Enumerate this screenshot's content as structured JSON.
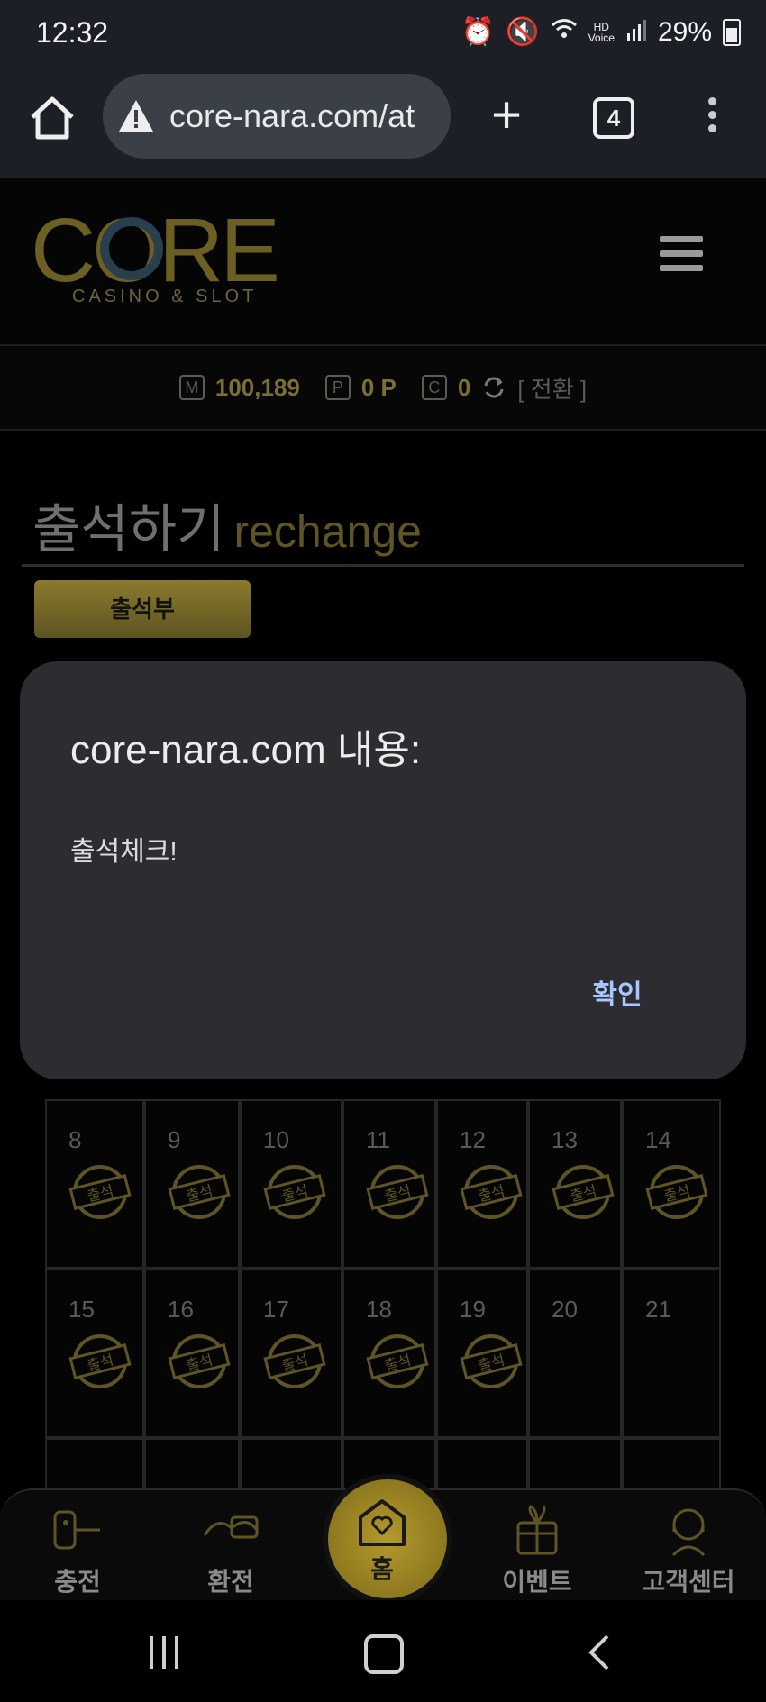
{
  "status": {
    "time": "12:32",
    "battery": "29%",
    "icons": [
      "alarm-icon",
      "mute-icon",
      "wifi-icon",
      "hd-voice-icon",
      "signal-icon",
      "battery-icon"
    ]
  },
  "browser": {
    "url": "core-nara.com/at",
    "tab_count": "4"
  },
  "site": {
    "logo_text": "CORE",
    "logo_sub": "CASINO & SLOT",
    "balance": {
      "m_badge": "M",
      "money": "100,189",
      "p_badge": "P",
      "points": "0 P",
      "c_badge": "C",
      "coins": "0",
      "switch_label": "[ 전환 ]"
    },
    "page_title_ko": "출석하기",
    "page_title_en": "rechange",
    "tab_label": "출석부"
  },
  "calendar": {
    "stamp_label": "출석",
    "rows": [
      [
        {
          "day": "8",
          "stamped": true
        },
        {
          "day": "9",
          "stamped": true
        },
        {
          "day": "10",
          "stamped": true
        },
        {
          "day": "11",
          "stamped": true
        },
        {
          "day": "12",
          "stamped": true
        },
        {
          "day": "13",
          "stamped": true
        },
        {
          "day": "14",
          "stamped": true
        }
      ],
      [
        {
          "day": "15",
          "stamped": true
        },
        {
          "day": "16",
          "stamped": true
        },
        {
          "day": "17",
          "stamped": true
        },
        {
          "day": "18",
          "stamped": true
        },
        {
          "day": "19",
          "stamped": true
        },
        {
          "day": "20",
          "stamped": false
        },
        {
          "day": "21",
          "stamped": false
        }
      ]
    ]
  },
  "dialog": {
    "title": "core-nara.com 내용:",
    "message": "출석체크!",
    "ok_label": "확인"
  },
  "bottom_nav": {
    "charge": "충전",
    "exchange": "환전",
    "home": "홈",
    "event": "이벤트",
    "support": "고객센터"
  },
  "colors": {
    "gold": "#7c6f32",
    "dialog_bg": "#2d2c31",
    "link_blue": "#a9c7ff"
  }
}
